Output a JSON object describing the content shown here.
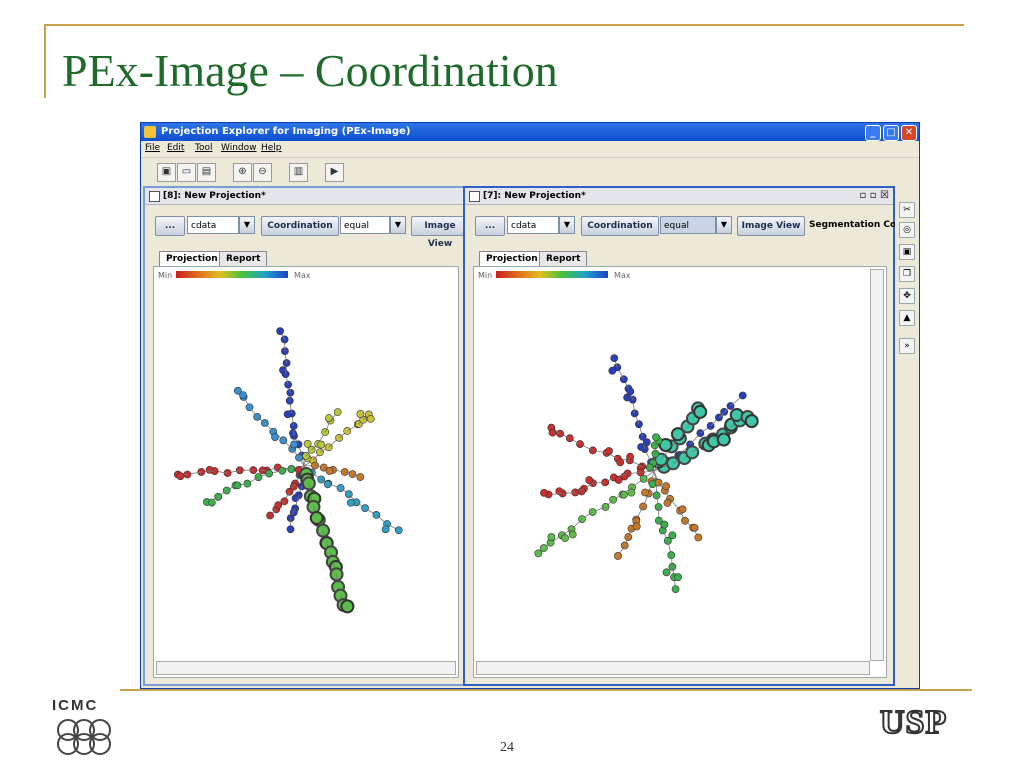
{
  "slide": {
    "title": "PEx-Image – Coordination",
    "page_number": "24"
  },
  "window": {
    "title": "Projection Explorer for Imaging (PEx-Image)",
    "menu": [
      "File",
      "Edit",
      "Tool",
      "Window",
      "Help"
    ]
  },
  "left_panel": {
    "title": "[8]: New Projection*",
    "ellipsis": "...",
    "data_select": "cdata",
    "coordination_label": "Coordination",
    "equal_select": "equal",
    "image_view_label": "Image View",
    "tabs": [
      "Projection",
      "Report"
    ],
    "legend_min": "Min",
    "legend_max": "Max"
  },
  "right_panel": {
    "title": "[7]: New Projection*",
    "ellipsis": "...",
    "data_select": "cdata",
    "coordination_label": "Coordination",
    "equal_select": "equal",
    "image_view_label": "Image View",
    "segmentation_label": "Segmentation Colo",
    "tabs": [
      "Projection",
      "Report"
    ],
    "legend_min": "Min",
    "legend_max": "Max"
  },
  "logos": {
    "left": "ICMC",
    "right": "USP"
  },
  "colors": {
    "title_green": "#1f6b2b",
    "accent_gold": "#c8a24a"
  }
}
